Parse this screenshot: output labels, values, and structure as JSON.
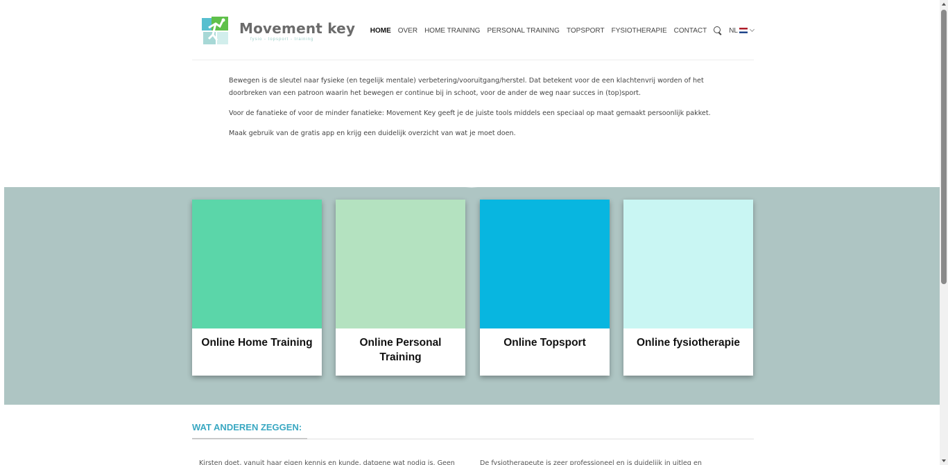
{
  "brand": {
    "name": "Movement key",
    "tagline": "fysio - topsport - training",
    "colors": {
      "green": "#5fc04a",
      "teal": "#39b4c7",
      "pale": "#a7d8d6"
    }
  },
  "nav": {
    "items": [
      {
        "label": "HOME",
        "active": true
      },
      {
        "label": "OVER"
      },
      {
        "label": "HOME TRAINING"
      },
      {
        "label": "PERSONAL TRAINING"
      },
      {
        "label": "TOPSPORT"
      },
      {
        "label": "FYSIOTHERAPIE"
      },
      {
        "label": "CONTACT"
      }
    ],
    "search_icon": "search-icon",
    "language": "NL"
  },
  "intro": {
    "p1": "Bewegen is de sleutel naar fysieke (en tegelijk mentale) verbetering/vooruitgang/herstel. Dat betekent voor de een klachtenvrij worden of het doorbreken van een patroon waarin het bewegen er continue bij in schoot, voor de ander de weg naar succes in (top)sport.",
    "p2": "Voor de fanatieke of voor de minder fanatieke: Movement Key geeft je de juiste tools middels een speciaal op maat gemaakt persoonlijk pakket.",
    "p3": "Maak gebruik van de gratis app en krijg een duidelijk overzicht van wat je moet doen."
  },
  "band": {
    "background": "#aec5c3"
  },
  "cards": [
    {
      "title": "Online Home Training",
      "color": "#5bd6a9"
    },
    {
      "title": "Online Personal Training",
      "color": "#b4e2c0"
    },
    {
      "title": "Online Topsport",
      "color": "#08b6e0"
    },
    {
      "title": "Online fysiotherapie",
      "color": "#c9f6f3"
    }
  ],
  "testimonials": {
    "title": "WAT ANDEREN ZEGGEN:",
    "items": [
      "Kirsten doet, vanuit haar eigen kennis en kunde, datgene wat nodig is. Geen",
      "De fysiotherapeute is zeer professioneel en is duidelijk in uitleg en"
    ]
  }
}
